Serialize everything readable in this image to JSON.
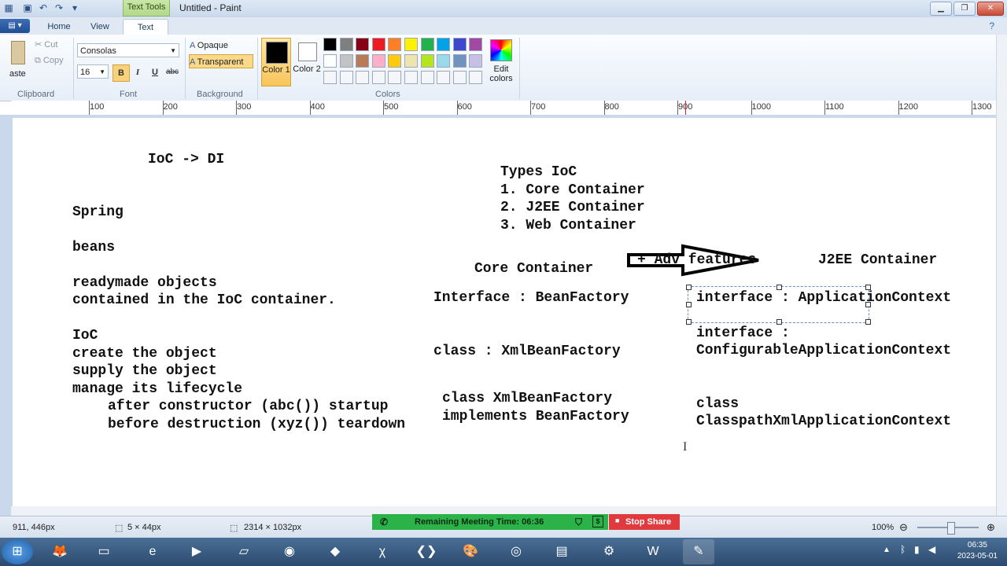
{
  "window": {
    "title": "Untitled - Paint",
    "context_tab": "Text Tools"
  },
  "tabs": [
    {
      "label": "Home"
    },
    {
      "label": "View"
    },
    {
      "label": "Text"
    }
  ],
  "clipboard": {
    "paste": "aste",
    "cut": "Cut",
    "copy": "Copy",
    "group_label": "Clipboard"
  },
  "font": {
    "family": "Consolas",
    "size": "16",
    "bold": "B",
    "italic": "I",
    "underline": "U",
    "strikethrough": "abc",
    "group_label": "Font"
  },
  "background": {
    "opaque": "Opaque",
    "transparent": "Transparent",
    "group_label": "Background"
  },
  "colors": {
    "color1_label": "Color 1",
    "color2_label": "Color 2",
    "color1_value": "#000000",
    "color2_value": "#ffffff",
    "edit_colors": "Edit colors",
    "group_label": "Colors",
    "palette_row1": [
      "#000000",
      "#7f7f7f",
      "#880015",
      "#ed1c24",
      "#ff7f27",
      "#fff200",
      "#22b14c",
      "#00a2e8",
      "#3f48cc",
      "#a349a4"
    ],
    "palette_row2": [
      "#ffffff",
      "#c3c3c3",
      "#b97a57",
      "#ffaec9",
      "#ffc90e",
      "#efe4b0",
      "#b5e61d",
      "#99d9ea",
      "#7092be",
      "#c8bfe7"
    ]
  },
  "ruler": {
    "ticks": [
      "100",
      "200",
      "300",
      "400",
      "500",
      "600",
      "700",
      "800",
      "900",
      "1000",
      "1100",
      "1200",
      "1300"
    ]
  },
  "canvas": {
    "left_column": {
      "ioc_di": "IoC -> DI",
      "spring": "Spring",
      "beans": "beans",
      "readymade": "readymade objects",
      "contained": "contained in the IoC container.",
      "ioc": "IoC",
      "create": "create the object",
      "supply": "supply the object",
      "manage": "manage its lifecycle",
      "after": "after constructor (abc()) startup",
      "before": "before destruction (xyz()) teardown"
    },
    "types": {
      "heading": "Types IoC",
      "item1": "1. Core Container",
      "item2": "2. J2EE Container",
      "item3": "3. Web Container"
    },
    "core": {
      "heading": "Core Container",
      "interface": "Interface : BeanFactory",
      "class": "class : XmlBeanFactory",
      "impl1": "class XmlBeanFactory",
      "impl2": "implements BeanFactory"
    },
    "adv": {
      "label": "+ Adv features"
    },
    "j2ee": {
      "heading": "J2EE Container",
      "interface": "interface : ApplicationContext",
      "interface2a": "interface :",
      "interface2b": "ConfigurableApplicationContext",
      "class_a": "class",
      "class_b": "ClasspathXmlApplicationContext"
    }
  },
  "status": {
    "cursor_pos": "911, 446px",
    "selection_size": "5 × 44px",
    "image_size": "2314 × 1032px",
    "zoom": "100%"
  },
  "meeting": {
    "remaining": "Remaining Meeting Time: 06:36",
    "stop_share": "Stop Share"
  },
  "taskbar": {
    "time": "06:35",
    "date": "2023-05-01"
  }
}
